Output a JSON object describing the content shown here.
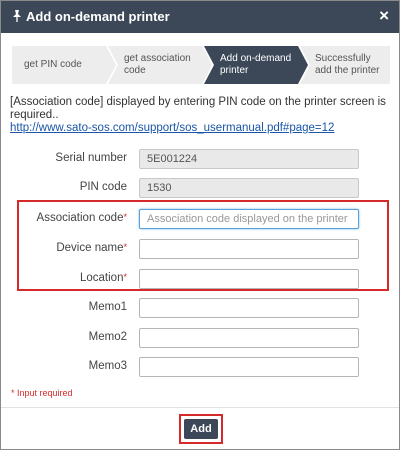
{
  "dialog": {
    "title": "Add on-demand printer",
    "close_label": "×"
  },
  "steps": [
    {
      "label": "get PIN code",
      "active": false
    },
    {
      "label": "get association code",
      "active": false
    },
    {
      "label": "Add on-demand printer",
      "active": true
    },
    {
      "label": "Successfully add the printer",
      "active": false
    }
  ],
  "intro": {
    "text": "[Association code] displayed by entering PIN code on the printer screen is required..",
    "link": "http://www.sato-sos.com/support/sos_usermanual.pdf#page=12"
  },
  "fields": {
    "serial": {
      "label": "Serial number",
      "value": "5E001224"
    },
    "pin": {
      "label": "PIN code",
      "value": "1530"
    },
    "association": {
      "label": "Association code",
      "required_mark": "*",
      "value": "",
      "placeholder": "Association code displayed on the printer"
    },
    "device": {
      "label": "Device name",
      "required_mark": "*",
      "value": "",
      "placeholder": ""
    },
    "location": {
      "label": "Location",
      "required_mark": "*",
      "value": "",
      "placeholder": ""
    },
    "memo1": {
      "label": "Memo1",
      "value": "",
      "placeholder": ""
    },
    "memo2": {
      "label": "Memo2",
      "value": "",
      "placeholder": ""
    },
    "memo3": {
      "label": "Memo3",
      "value": "",
      "placeholder": ""
    }
  },
  "required_note": "* Input required",
  "add_button": "Add",
  "colors": {
    "titlebar": "#3c4858",
    "active_step": "#3c4858",
    "highlight": "#d62a2a",
    "link": "#1a56a8"
  }
}
